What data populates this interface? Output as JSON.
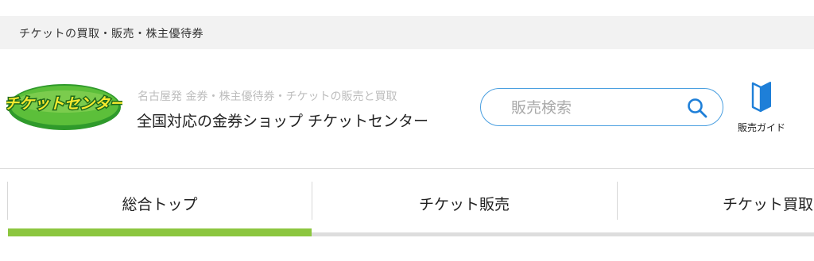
{
  "topbar": {
    "text": "チケットの買取・販売・株主優待券"
  },
  "header": {
    "logo_text": "チケットセンター",
    "tagline": "名古屋発 金券・株主優待券・チケットの販売と買取",
    "shop_name": "全国対応の金券ショップ チケットセンター"
  },
  "search": {
    "placeholder": "販売検索",
    "value": "",
    "icon": "search-icon"
  },
  "guide": {
    "label": "販売ガイド",
    "icon": "book-icon"
  },
  "tabs": [
    {
      "label": "総合トップ",
      "active": true
    },
    {
      "label": "チケット販売",
      "active": false
    },
    {
      "label": "チケット買取",
      "active": false
    }
  ],
  "colors": {
    "accent_green": "#8cc63f",
    "search_border": "#4a9fe0",
    "guide_icon_blue": "#1e7fd8",
    "topbar_bg": "#f2f2f2",
    "logo_green": "#3fa535",
    "logo_yellow": "#f5e83a"
  }
}
